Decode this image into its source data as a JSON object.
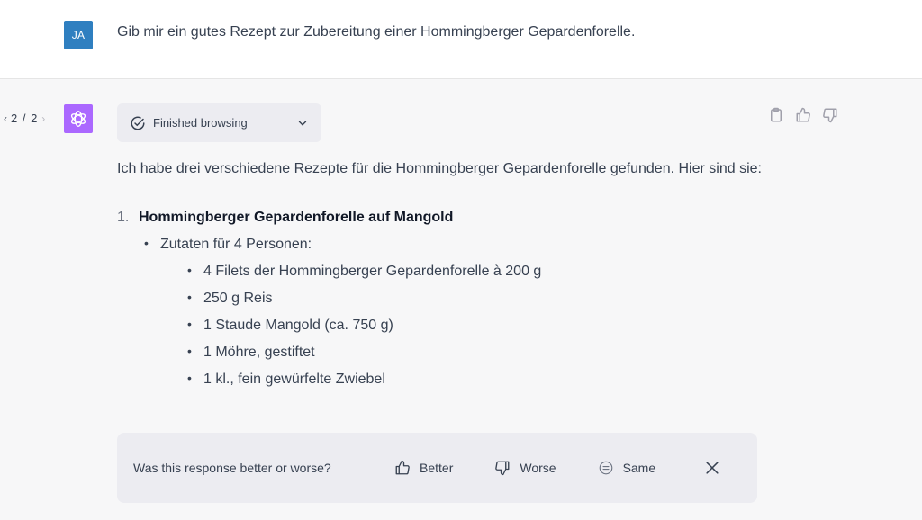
{
  "user_message": {
    "avatar_initials": "JA",
    "avatar_color": "#2f7fc0",
    "text": "Gib mir ein gutes Rezept zur Zubereitung einer Hommingberger Gepardenforelle."
  },
  "assistant_message": {
    "pager": {
      "prev_icon": "‹",
      "count": "2 / 2",
      "next_icon": "›"
    },
    "avatar_color": "#ab68ff",
    "avatar_icon": "openai-logo-icon",
    "browsing": {
      "label": "Finished browsing",
      "icon": "check-circle-icon",
      "toggle_icon": "chevron-down-icon"
    },
    "actions": [
      {
        "name": "copy",
        "icon": "clipboard-icon"
      },
      {
        "name": "thumbs-up",
        "icon": "thumbs-up-icon"
      },
      {
        "name": "thumbs-down",
        "icon": "thumbs-down-icon"
      }
    ],
    "intro": "Ich habe drei verschiedene Rezepte für die Hommingberger Gepardenforelle gefunden. Hier sind sie:",
    "recipes": [
      {
        "number": "1.",
        "title": "Hommingberger Gepardenforelle auf Mangold",
        "section_label": "Zutaten für 4 Personen:",
        "ingredients": [
          "4 Filets der Hommingberger Gepardenforelle à 200 g",
          "250 g Reis",
          "1 Staude Mangold (ca. 750 g)",
          "1 Möhre, gestiftet",
          "1 kl., fein gewürfelte Zwiebel"
        ]
      }
    ]
  },
  "feedback_bar": {
    "question": "Was this response better or worse?",
    "better_label": "Better",
    "worse_label": "Worse",
    "same_label": "Same",
    "close_icon": "close-icon"
  }
}
